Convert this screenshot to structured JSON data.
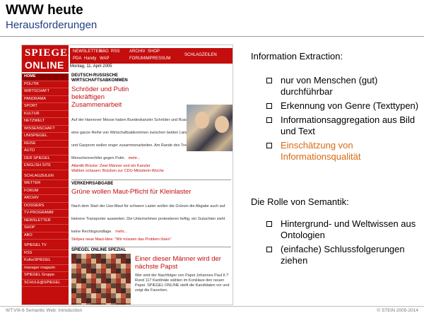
{
  "slide": {
    "title": "WWW heute",
    "subtitle": "Herausforderungen",
    "footer_left": "WT:VIII-6   Semantic Web: Introduction",
    "footer_right": "© STEIN 2005-2014"
  },
  "colors": {
    "spiegel_red": "#c40d0d",
    "subtitle_blue": "#1f3f7f",
    "highlight_orange": "#d86a10"
  },
  "screenshot": {
    "logo_line1": "SPIEGEL",
    "logo_line2": "ONLINE",
    "topnav": [
      "NEWSLETTER",
      "ABO",
      "RSS",
      "PDA",
      "Handy",
      "WAP",
      "ARCHIV",
      "SHOP",
      "FORUM",
      "IMPRESSUM",
      "SCHLAGZEILEN"
    ],
    "date": "Montag, 11. April 2005",
    "sidebar": [
      "HOME",
      "POLITIK",
      "WIRTSCHAFT",
      "PANORAMA",
      "SPORT",
      "KULTUR",
      "NETZWELT",
      "WISSENSCHAFT",
      "UNISPIEGEL",
      "REISE",
      "AUTO",
      "DER SPIEGEL",
      "ENGLISH SITE",
      "SCHLAGZEILEN",
      "WETTER",
      "FORUM",
      "ARCHIV",
      "DOSSIERS",
      "TV-PROGRAMM",
      "NEWSLETTER",
      "SHOP",
      "ABO",
      "SPIEGEL TV",
      "RSS",
      "KulturSPIEGEL",
      "manager magazin",
      "SPIEGEL Gruppe",
      "SCHULE@SPIEGEL"
    ],
    "story1": {
      "kicker": "DEUTSCH-RUSSISCHE WIRTSCHAFTSABKOMMEN",
      "headline": "Schröder und Putin bekräftigen Zusammenarbeit",
      "body": "Auf der Hannover Messe haben Bundeskanzler Schröder und Russlands Präsident Putin eine ganze Reihe von Wirtschaftsabkommen zwischen beiden Ländern unterzeichnet. VW und Gazprom wollen enger zusammenarbeiten. Am Rande des Treffens protestierten Menschenrechtler gegen Putin.",
      "more": "mehr...",
      "link1": "Atlantik-Brücke: Zwei Männer und ein Kanzler",
      "link2": "Wahlen schauen: Brücken zur CDU-Ministerin-Woche"
    },
    "story2": {
      "kicker": "VERKEHRSABGABE",
      "headline": "Grüne wollen Maut-Pflicht für Kleinlaster",
      "body": "Nach dem Start der Lkw-Maut für schwere Laster wollen die Grünen die Abgabe auch auf kleinere Transporter ausweiten. Die Unternehmen protestieren heftig, ein Gutachten sieht keine Rechtsgrundlage.",
      "more": "mehr...",
      "link1": "Stolpes neue Maut-Idee: \"Wir müssen das Problem lösen\""
    },
    "spezial": {
      "kicker": "SPIEGEL ONLINE SPEZIAL",
      "headline": "Einer dieser Männer wird der nächste Papst",
      "body": "Wer wird der Nachfolger von Papst Johannes Paul II.? Rund 117 Kardinäle wählen im Konklave den neuen Papst. SPIEGEL ONLINE stellt die Kandidaten vor und zeigt die Favoriten."
    }
  },
  "info_extraction": {
    "heading": "Information Extraction:",
    "items": [
      "nur von Menschen (gut) durchführbar",
      "Erkennung von Genre (Texttypen)",
      "Informationsaggregation aus Bild und Text",
      "Einschätzung von Informationsqualität"
    ]
  },
  "semantics": {
    "heading": "Die Rolle von Semantik:",
    "items": [
      "Hintergrund- und Weltwissen aus Ontologien",
      "(einfache) Schlussfolgerungen ziehen"
    ]
  }
}
